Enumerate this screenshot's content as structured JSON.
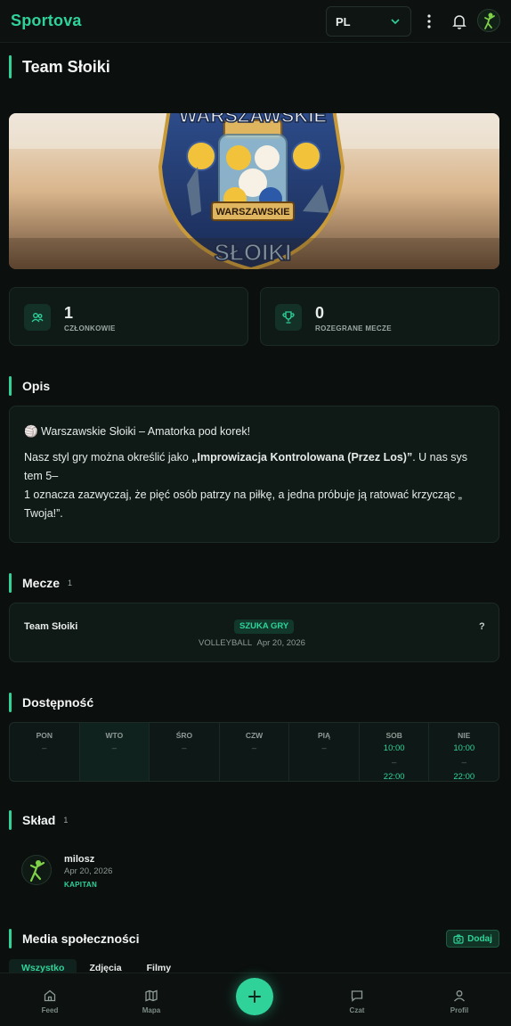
{
  "app": {
    "logo": "Sportova"
  },
  "header": {
    "language": "PL"
  },
  "team": {
    "name": "Team Słoiki"
  },
  "stats": [
    {
      "value": "1",
      "label": "CZŁONKOWIE",
      "icon": "users-icon"
    },
    {
      "value": "0",
      "label": "ROZEGRANE MECZE",
      "icon": "trophy-icon"
    }
  ],
  "description": {
    "title": "Opis",
    "line1": "🏐 Warszawskie Słoiki – Amatorka pod korek!",
    "para_start": "Nasz styl gry można określić jako ",
    "para_bold": "„Improwizacja Kontrolowana (Przez Los)”",
    "para_mid": ". U nas sys tem 5–",
    "para_line2": "1 oznacza zazwyczaj, że pięć osób patrzy na piłkę, a jedna próbuje ją ratować krzycząc „ Twoja!”."
  },
  "matches": {
    "title": "Mecze",
    "count": "1",
    "items": [
      {
        "team": "Team Słoiki",
        "status": "SZUKA GRY",
        "sport": "VOLLEYBALL",
        "date": "Apr 20, 2026",
        "opponent": "?"
      }
    ]
  },
  "availability": {
    "title": "Dostępność",
    "days": [
      {
        "name": "PON",
        "value": "–",
        "from": "",
        "sep": "",
        "to": ""
      },
      {
        "name": "WTO",
        "value": "–",
        "from": "",
        "sep": "",
        "to": ""
      },
      {
        "name": "ŚRO",
        "value": "–",
        "from": "",
        "sep": "",
        "to": ""
      },
      {
        "name": "CZW",
        "value": "–",
        "from": "",
        "sep": "",
        "to": ""
      },
      {
        "name": "PIĄ",
        "value": "–",
        "from": "",
        "sep": "",
        "to": ""
      },
      {
        "name": "SOB",
        "value": "",
        "from": "10:00",
        "sep": "–",
        "to": "22:00"
      },
      {
        "name": "NIE",
        "value": "",
        "from": "10:00",
        "sep": "–",
        "to": "22:00"
      }
    ]
  },
  "roster": {
    "title": "Skład",
    "count": "1",
    "members": [
      {
        "name": "milosz",
        "date": "Apr 20, 2026",
        "role": "KAPITAN"
      }
    ]
  },
  "media": {
    "title": "Media społeczności",
    "add_label": "Dodaj",
    "tabs": [
      "Wszystko",
      "Zdjęcia",
      "Filmy"
    ]
  },
  "nav": {
    "feed": "Feed",
    "map": "Mapa",
    "chat": "Czat",
    "profile": "Profil"
  },
  "colors": {
    "accent": "#2fd39a",
    "background": "#0b0f0e",
    "card": "#0f1a17"
  }
}
